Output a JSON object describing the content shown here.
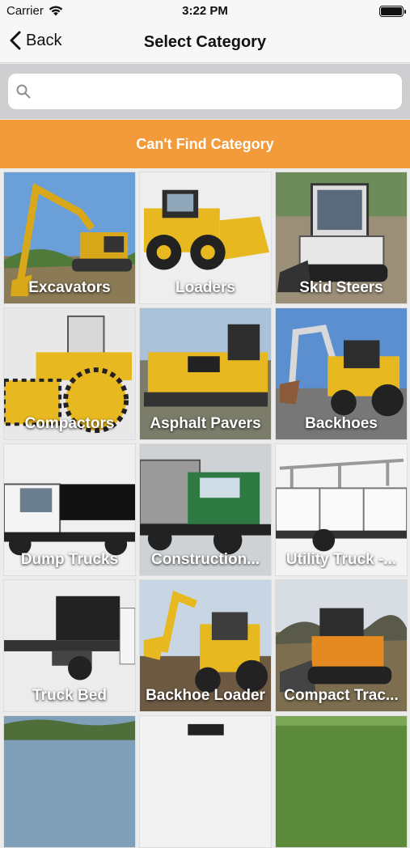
{
  "status_bar": {
    "carrier": "Carrier",
    "time": "3:22 PM",
    "wifi_icon": "wifi-icon",
    "battery_icon": "battery-icon"
  },
  "nav": {
    "back_label": "Back",
    "title": "Select Category",
    "back_icon": "chevron-left-icon"
  },
  "search": {
    "placeholder": "",
    "value": "",
    "icon": "search-icon"
  },
  "cta": {
    "label": "Can't Find Category"
  },
  "colors": {
    "accent": "#f39a3a",
    "machine_yellow": "#e8b820"
  },
  "categories": [
    {
      "label": "Excavators"
    },
    {
      "label": "Loaders"
    },
    {
      "label": "Skid Steers"
    },
    {
      "label": "Compactors"
    },
    {
      "label": "Asphalt Pavers"
    },
    {
      "label": "Backhoes"
    },
    {
      "label": "Dump Trucks"
    },
    {
      "label": "Construction..."
    },
    {
      "label": "Utility Truck -..."
    },
    {
      "label": "Truck Bed"
    },
    {
      "label": "Backhoe Loader"
    },
    {
      "label": "Compact Trac..."
    },
    {
      "label": ""
    },
    {
      "label": ""
    },
    {
      "label": ""
    }
  ]
}
